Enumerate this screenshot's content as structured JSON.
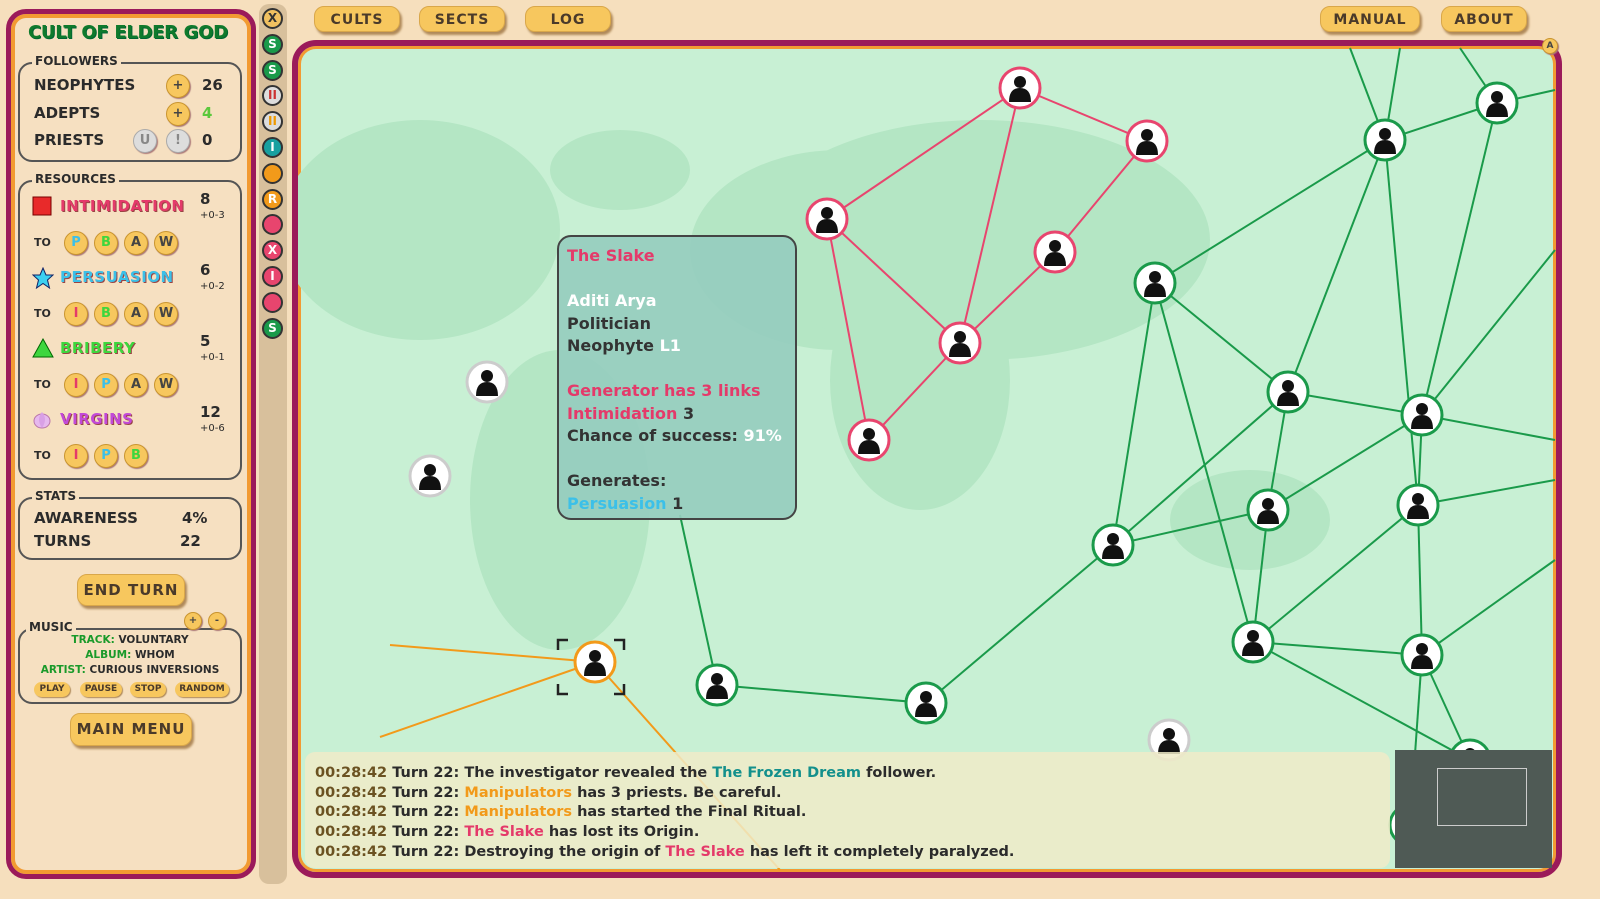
{
  "cult": {
    "title": "CULT OF ELDER GOD"
  },
  "followers": {
    "legend": "FOLLOWERS",
    "neophytes_label": "NEOPHYTES",
    "neophytes": "26",
    "adepts_label": "ADEPTS",
    "adepts": "4",
    "priests_label": "PRIESTS",
    "priests": "0",
    "plus": "+",
    "upgrade": "U",
    "alert": "!"
  },
  "resources": {
    "legend": "RESOURCES",
    "to": "TO",
    "items": [
      {
        "name": "INTIMIDATION",
        "value": "8",
        "range": "+0-3",
        "color": "#e43a6a",
        "icon": "red-square",
        "convert": [
          "P",
          "B",
          "A",
          "W"
        ]
      },
      {
        "name": "PERSUASION",
        "value": "6",
        "range": "+0-2",
        "color": "#3cc0e8",
        "icon": "blue-star",
        "convert": [
          "I",
          "B",
          "A",
          "W"
        ]
      },
      {
        "name": "BRIBERY",
        "value": "5",
        "range": "+0-1",
        "color": "#3ed63e",
        "icon": "green-triangle",
        "convert": [
          "I",
          "P",
          "A",
          "W"
        ]
      },
      {
        "name": "VIRGINS",
        "value": "12",
        "range": "+0-6",
        "color": "#c24ad8",
        "icon": "lotus",
        "convert": [
          "I",
          "P",
          "B"
        ]
      }
    ]
  },
  "stats": {
    "legend": "STATS",
    "awareness_label": "AWARENESS",
    "awareness": "4%",
    "turns_label": "TURNS",
    "turns": "22"
  },
  "end_turn": "END TURN",
  "music": {
    "legend": "MUSIC",
    "vol_up": "+",
    "vol_down": "-",
    "track_label": "TRACK:",
    "track": "VOLUNTARY",
    "album_label": "ALBUM:",
    "album": "WHOM",
    "artist_label": "ARTIST:",
    "artist": "CURIOUS INVERSIONS",
    "play": "PLAY",
    "pause": "PAUSE",
    "stop": "STOP",
    "random": "RANDOM"
  },
  "main_menu": "MAIN MENU",
  "cult_icons": [
    {
      "l": "X",
      "c": "#f0c060",
      "fg": "#333"
    },
    {
      "l": "S",
      "c": "#1a9a4a"
    },
    {
      "l": "S",
      "c": "#1a9a4a"
    },
    {
      "l": "II",
      "c": "#ddd",
      "fg": "#c33"
    },
    {
      "l": "II",
      "c": "#ddd",
      "fg": "#e90"
    },
    {
      "l": "I",
      "c": "#18a0a0"
    },
    {
      "l": "",
      "c": "#f29a1a"
    },
    {
      "l": "R",
      "c": "#f29a1a"
    },
    {
      "l": "",
      "c": "#e8456e"
    },
    {
      "l": "X",
      "c": "#e8456e"
    },
    {
      "l": "I",
      "c": "#e8456e"
    },
    {
      "l": "",
      "c": "#e8456e"
    },
    {
      "l": "S",
      "c": "#1a9a4a"
    }
  ],
  "top": {
    "cults": "CULTS",
    "sects": "SECTS",
    "log": "LOG",
    "manual": "MANUAL",
    "about": "ABOUT",
    "corner": "A"
  },
  "tooltip": {
    "cult": "The Slake",
    "name": "Aditi Arya",
    "job": "Politician",
    "rank": "Neophyte",
    "level": "L1",
    "gen": "Generator has 3 links",
    "res": "Intimidation",
    "res_val": "3",
    "chance_label": "Chance of success:",
    "chance": "91%",
    "generates": "Generates:",
    "gen_res": "Persuasion",
    "gen_val": "1"
  },
  "log": [
    {
      "time": "00:28:42",
      "turn": "Turn 22:",
      "pre": "The investigator revealed the ",
      "hl": "The Frozen Dream",
      "hlc": "#13908c",
      "post": " follower."
    },
    {
      "time": "00:28:42",
      "turn": "Turn 22:",
      "pre": "",
      "hl": "Manipulators",
      "hlc": "#f29a1a",
      "post": " has 3 priests. Be careful."
    },
    {
      "time": "00:28:42",
      "turn": "Turn 22:",
      "pre": "",
      "hl": "Manipulators",
      "hlc": "#f29a1a",
      "post": " has started the Final Ritual."
    },
    {
      "time": "00:28:42",
      "turn": "Turn 22:",
      "pre": "",
      "hl": "The Slake",
      "hlc": "#e43a6a",
      "post": " has lost its Origin."
    },
    {
      "time": "00:28:42",
      "turn": "Turn 22:",
      "pre": "Destroying the origin of ",
      "hl": "The Slake",
      "hlc": "#e43a6a",
      "post": " has left it completely paralyzed."
    }
  ],
  "colors": {
    "slake": "#e8456e",
    "green_cult": "#1a9a4a",
    "manipulators": "#f29a1a",
    "neutral": "#cccccc"
  }
}
